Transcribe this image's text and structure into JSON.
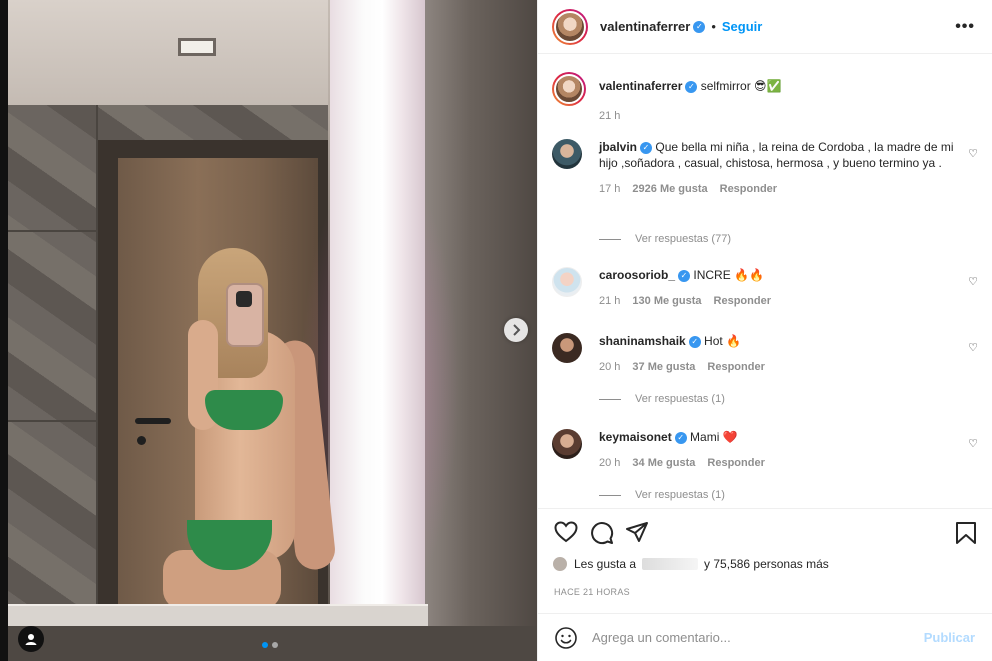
{
  "post": {
    "author": "valentinaferrer",
    "follow_label": "Seguir",
    "caption": "selfmirror 😎✅",
    "caption_time": "21 h",
    "more_label": "•••"
  },
  "comments": [
    {
      "user": "jbalvin",
      "verified": true,
      "text": "Que bella mi niña , la reina de Cordoba , la madre de mi hijo ,soñadora , casual, chistosa, hermosa , y bueno termino ya .",
      "time": "17 h",
      "likes": "2926 Me gusta",
      "reply": "Responder",
      "view_replies": "Ver respuestas (77)"
    },
    {
      "user": "caroosoriob_",
      "verified": true,
      "text": "INCRE 🔥🔥",
      "time": "21 h",
      "likes": "130 Me gusta",
      "reply": "Responder",
      "view_replies": ""
    },
    {
      "user": "shaninamshaik",
      "verified": true,
      "text": "Hot 🔥",
      "time": "20 h",
      "likes": "37 Me gusta",
      "reply": "Responder",
      "view_replies": "Ver respuestas (1)"
    },
    {
      "user": "keymaisonet",
      "verified": true,
      "text": "Mami ❤️",
      "time": "20 h",
      "likes": "34 Me gusta",
      "reply": "Responder",
      "view_replies": "Ver respuestas (1)"
    }
  ],
  "likes_text": {
    "prefix": "Les gusta a",
    "suffix": "y 75,586 personas más"
  },
  "post_time": "HACE 21 HORAS",
  "comment_box": {
    "placeholder": "Agrega un comentario...",
    "publish_label": "Publicar"
  },
  "colors": {
    "accent": "#0095f6",
    "verified": "#3897f0",
    "publish_disabled": "#b3dbff"
  },
  "icons": [
    "chevron-right-icon",
    "user-tag-icon",
    "heart-icon",
    "comment-icon",
    "share-icon",
    "bookmark-icon",
    "emoji-icon"
  ]
}
